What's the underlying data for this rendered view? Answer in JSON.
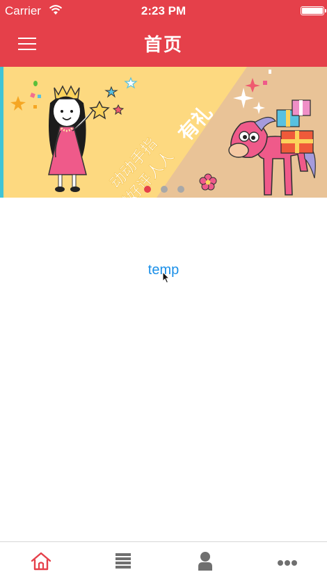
{
  "status_bar": {
    "carrier": "Carrier",
    "time": "2:23 PM"
  },
  "nav": {
    "title": "首页",
    "menu_icon": "hamburger-menu-icon",
    "background_color": "#e5404a"
  },
  "banner": {
    "slogan_line1": "动动手指",
    "slogan_line2": "赠好评人人",
    "slogan_emphasis": "有礼",
    "page_count": 3,
    "active_page": 1,
    "active_dot_color": "#e5404a",
    "inactive_dot_color": "#a8a8a8"
  },
  "content": {
    "link_text": "temp",
    "link_color": "#1a8fe8"
  },
  "tabbar": {
    "tabs": [
      {
        "icon": "home-icon",
        "active": true
      },
      {
        "icon": "list-icon",
        "active": false
      },
      {
        "icon": "person-icon",
        "active": false
      },
      {
        "icon": "more-icon",
        "active": false
      }
    ],
    "active_color": "#e5404a",
    "inactive_color": "#6f6f6f"
  }
}
